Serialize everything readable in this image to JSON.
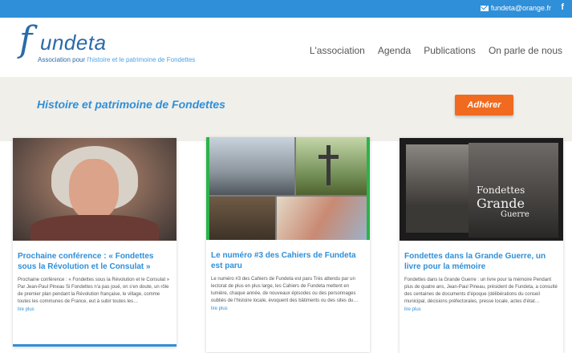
{
  "topbar": {
    "email": "fundeta@orange.fr",
    "facebook": "f"
  },
  "logo": {
    "initial": "f",
    "name": "undeta",
    "tag_prefix": "Association pour ",
    "tag_highlight": "l'histoire et le patrimoine de Fondettes"
  },
  "nav": [
    "L'association",
    "Agenda",
    "Publications",
    "On parle de nous"
  ],
  "hero": {
    "title": "Histoire et patrimoine de Fondettes",
    "button": "Adhérer"
  },
  "cards": [
    {
      "title": "Prochaine conférence : « Fondettes sous la Révolution et le Consulat »",
      "text": "Prochaine conférence : « Fondettes sous la Révolution et le Consulat » Par Jean-Paul Pineau Si Fondettes n'a pas joué, on s'en doute, un rôle de premier plan pendant la Révolution française, le village, comme toutes les communes de France, eut à subir toutes les…",
      "more": "lire plus"
    },
    {
      "title": "Le numéro #3 des Cahiers de Fundeta est paru",
      "text": "Le numéro #3 des Cahiers de Fundeta est paru Très attendu par un lectorat de plus en plus large, les Cahiers de Fundeta mettent en lumière, chaque année, de nouveaux épisodes ou des personnages oubliés de l'histoire locale, évoquent des bâtiments ou des sites du…",
      "more": "lire plus"
    },
    {
      "title": "Fondettes dans la Grande Guerre, un livre pour la mémoire",
      "text": "Fondettes dans la Grande Guerre : un livre pour la mémoire Pendant plus de quatre ans, Jean-Paul Pineau, président de Fundeta, a consulté des centaines de documents d'époque (délibérations du conseil municipal, décisions préfectorales, presse locale, actes d'état…",
      "more": "lire plus",
      "book": {
        "line1": "Fondettes",
        "line2": "Grande",
        "line3": "Guerre"
      }
    }
  ],
  "colors": {
    "primary": "#2f8fd8",
    "accent": "#f06a1f",
    "hero_bg": "#f1efea"
  }
}
